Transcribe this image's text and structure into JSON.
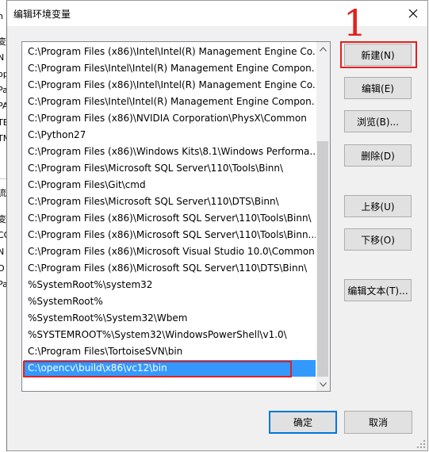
{
  "dialog": {
    "title": "编辑环境变量",
    "close_icon": "close-icon"
  },
  "background_window": {
    "fragments": [
      "n",
      "变",
      "N",
      "op",
      "Pa",
      "PA",
      "TE",
      "TM",
      "流",
      "变",
      "CO",
      "N",
      "O",
      "Pa"
    ]
  },
  "path_list": {
    "items": [
      "C:\\Program Files (x86)\\Intel\\Intel(R) Management Engine Co...",
      "C:\\Program Files\\Intel\\Intel(R) Management Engine Compon...",
      "C:\\Program Files (x86)\\Intel\\Intel(R) Management Engine Co...",
      "C:\\Program Files\\Intel\\Intel(R) Management Engine Compon...",
      "C:\\Program Files (x86)\\NVIDIA Corporation\\PhysX\\Common",
      "C:\\Python27",
      "C:\\Program Files (x86)\\Windows Kits\\8.1\\Windows Performa...",
      "C:\\Program Files\\Microsoft SQL Server\\110\\Tools\\Binn\\",
      "C:\\Program Files\\Git\\cmd",
      "C:\\Program Files\\Microsoft SQL Server\\110\\DTS\\Binn\\",
      "C:\\Program Files (x86)\\Microsoft SQL Server\\110\\Tools\\Binn\\",
      "C:\\Program Files (x86)\\Microsoft SQL Server\\110\\Tools\\Binn...",
      "C:\\Program Files (x86)\\Microsoft Visual Studio 10.0\\Common...",
      "C:\\Program Files (x86)\\Microsoft SQL Server\\110\\DTS\\Binn\\",
      "%SystemRoot%\\system32",
      "%SystemRoot%",
      "%SystemRoot%\\System32\\Wbem",
      "%SYSTEMROOT%\\System32\\WindowsPowerShell\\v1.0\\",
      "C:\\Program Files\\TortoiseSVN\\bin",
      "C:\\opencv\\build\\x86\\vc12\\bin"
    ],
    "selected_index": 19
  },
  "buttons": {
    "new": "新建(N)",
    "edit": "编辑(E)",
    "browse": "浏览(B)...",
    "delete": "删除(D)",
    "move_up": "上移(U)",
    "move_down": "下移(O)",
    "edit_text": "编辑文本(T)...",
    "ok": "确定",
    "cancel": "取消"
  },
  "annotation": {
    "step_number": "1",
    "color": "#e02020"
  },
  "colors": {
    "selection": "#3399ff",
    "dialog_bg": "#f0f0f0",
    "button_bg": "#e1e1e1",
    "default_button_border": "#0078d7"
  }
}
